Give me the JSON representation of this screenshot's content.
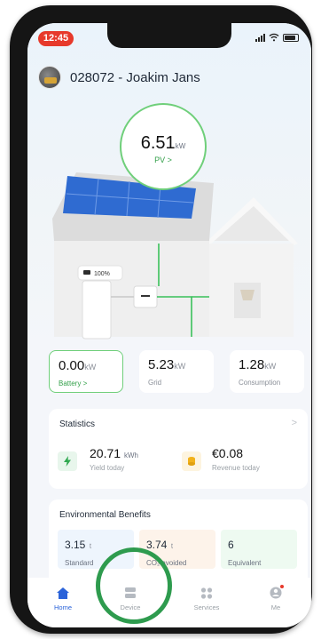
{
  "status_bar": {
    "time": "12:45"
  },
  "header": {
    "title": "028072 - Joakim Jans"
  },
  "pv": {
    "value": "6.51",
    "unit": "kW",
    "label": "PV >"
  },
  "house": {
    "battery_badge": "100%"
  },
  "metrics": [
    {
      "value": "0.00",
      "unit": "kW",
      "label": "Battery >"
    },
    {
      "value": "5.23",
      "unit": "kW",
      "label": "Grid"
    },
    {
      "value": "1.28",
      "unit": "kW",
      "label": "Consumption"
    }
  ],
  "statistics": {
    "title": "Statistics",
    "chevron": ">",
    "yield": {
      "value": "20.71",
      "unit": "kWh",
      "label": "Yield today"
    },
    "revenue": {
      "value": "€0.08",
      "label": "Revenue today"
    }
  },
  "environment": {
    "title": "Environmental Benefits",
    "items": [
      {
        "value": "3.15",
        "unit": "t",
        "label": "Standard",
        "color": "#eef5fd"
      },
      {
        "value": "3.74",
        "unit": "t",
        "label": "CO₂ avoided",
        "color": "#fdf3ea"
      },
      {
        "value": "6",
        "unit": "",
        "label": "Equivalent",
        "color": "#eefaf1"
      }
    ]
  },
  "tabs": [
    {
      "label": "Home",
      "icon": "home-icon"
    },
    {
      "label": "Device",
      "icon": "device-icon"
    },
    {
      "label": "Services",
      "icon": "grid-icon"
    },
    {
      "label": "Me",
      "icon": "person-icon"
    }
  ],
  "colors": {
    "accent_green": "#6fcf7a",
    "tab_active": "#2b63d9",
    "highlight": "#2e9b4e",
    "status_red": "#e7392b"
  }
}
